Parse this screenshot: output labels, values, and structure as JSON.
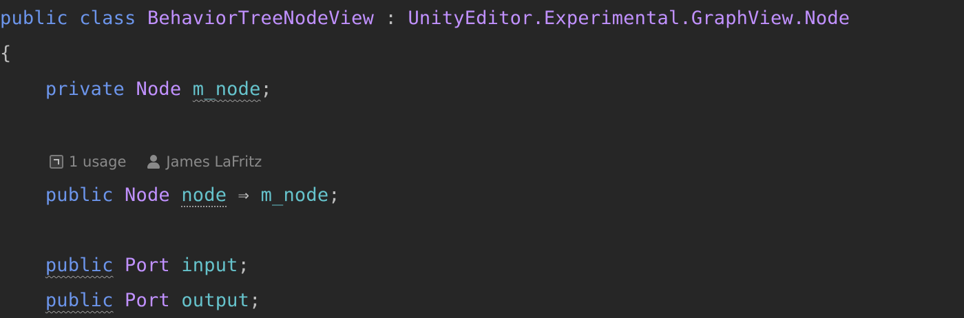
{
  "code": {
    "line1": {
      "kw1": "public",
      "kw2": "class",
      "class_name": "BehaviorTreeNodeView",
      "colon": ":",
      "base": "UnityEditor.Experimental.GraphView.Node"
    },
    "line2": {
      "brace": "{"
    },
    "line3": {
      "kw": "private",
      "type": "Node",
      "name": "m_node",
      "semi": ";"
    },
    "hint": {
      "usage": "1 usage",
      "author": "James LaFritz"
    },
    "line4": {
      "kw": "public",
      "type": "Node",
      "name": "node",
      "arrow": "⇒",
      "target": "m_node",
      "semi": ";"
    },
    "line5": {
      "kw": "public",
      "type": "Port",
      "name": "input",
      "semi": ";"
    },
    "line6": {
      "kw": "public",
      "type": "Port",
      "name": "output",
      "semi": ";"
    }
  },
  "colors": {
    "background": "#262626",
    "keyword": "#6c95eb",
    "type": "#c191ff",
    "member": "#66c3cc",
    "text": "#bdbdbd",
    "hint": "#8a8a8a"
  },
  "icons": [
    "usage-icon",
    "author-icon"
  ]
}
